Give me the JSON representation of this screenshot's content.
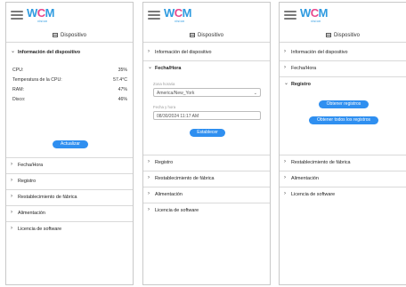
{
  "logo": {
    "w": "W",
    "c": "C",
    "m": "M",
    "sub": "vision"
  },
  "title": "Dispositivo",
  "screens": [
    {
      "sections": [
        "Información del dispositivo",
        "Fecha/Hora",
        "Registro",
        "Restablecimiento de fábrica",
        "Alimentación",
        "Licencia de software"
      ],
      "device_info": {
        "rows": [
          {
            "label": "CPU:",
            "value": "35%"
          },
          {
            "label": "Temperatura de la CPU:",
            "value": "57.4°C"
          },
          {
            "label": "RAM:",
            "value": "47%"
          },
          {
            "label": "Disco:",
            "value": "46%"
          }
        ],
        "button": "Actualizar"
      }
    },
    {
      "sections": [
        "Información del dispositivo",
        "Fecha/Hora",
        "Registro",
        "Restablecimiento de fábrica",
        "Alimentación",
        "Licencia de software"
      ],
      "datetime": {
        "zone_label": "Zona horaria",
        "zone_value": "America/New_York",
        "datetime_label": "Fecha y hora",
        "datetime_value": "08/30/2024 11:17 AM",
        "button": "Establecer"
      }
    },
    {
      "sections": [
        "Información del dispositivo",
        "Fecha/Hora",
        "Registro",
        "Restablecimiento de fábrica",
        "Alimentación",
        "Licencia de software"
      ],
      "registro": {
        "button1": "Obtener registros",
        "button2": "Obtener todos los registros"
      }
    }
  ],
  "colors": {
    "accent": "#2f8ff0",
    "logo_blue": "#2f9be0",
    "logo_pink": "#e8478b"
  },
  "icons": {
    "menu": "hamburger-icon",
    "chevron_right": "chevron-right-icon",
    "chevron_down": "chevron-down-icon",
    "device": "device-icon",
    "dropdown": "dropdown-icon"
  }
}
